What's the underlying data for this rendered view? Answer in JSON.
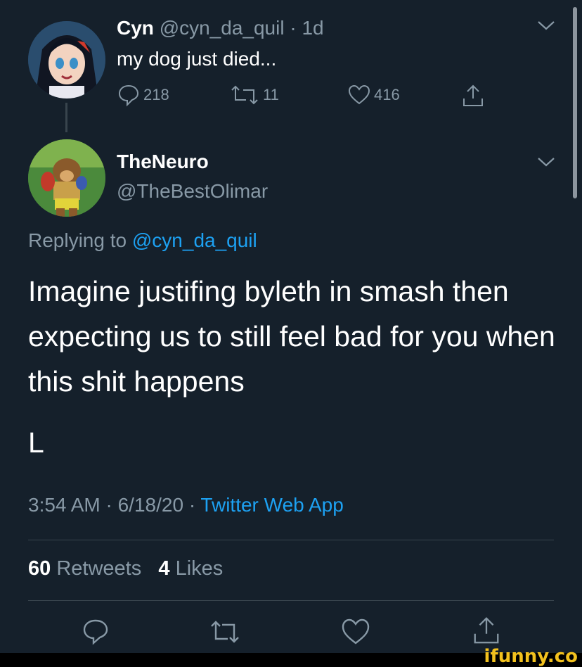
{
  "parent_tweet": {
    "name": "Cyn",
    "handle": "@cyn_da_quil",
    "time": "· 1d",
    "text": "my dog just died...",
    "reply_count": "218",
    "retweet_count": "11",
    "like_count": "416",
    "avatar_icon": "anime-girl-avatar"
  },
  "main_tweet": {
    "name": "TheNeuro",
    "handle": "@TheBestOlimar",
    "replying_prefix": "Replying to",
    "replying_handle": "@cyn_da_quil",
    "text": "Imagine justifing byleth in smash then expecting us to still feel bad for you when this shit happens",
    "text_line2": "L",
    "timestamp": "3:54 AM · 6/18/20 · ",
    "source": "Twitter Web App",
    "retweets_count": "60",
    "retweets_label": "Retweets",
    "likes_count": "4",
    "likes_label": "Likes",
    "avatar_icon": "banjo-kazooie-avatar"
  },
  "watermark": "ifunny.co",
  "colors": {
    "background": "#15202b",
    "muted": "#8899a6",
    "link": "#1da1f2",
    "divider": "#38444d"
  }
}
